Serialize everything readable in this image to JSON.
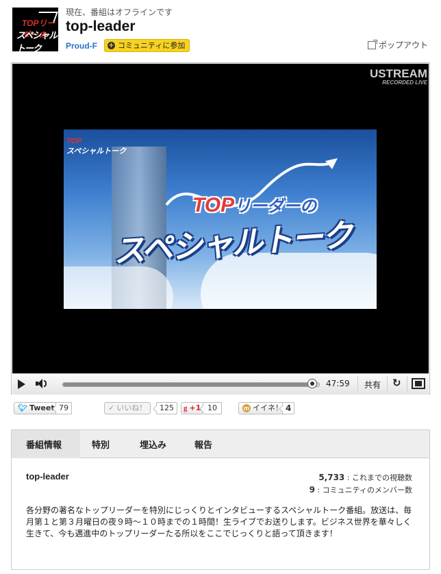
{
  "header": {
    "status": "現在、番組はオフラインです",
    "title": "top-leader",
    "channel": "Proud-F",
    "join_label": "コミュニティに参加",
    "popout_label": "ポップアウト",
    "logo_line1": "TOPリーダーの",
    "logo_line2": "スペシャルトーク"
  },
  "player": {
    "brand": "USTREAM",
    "badge": "RECORDED LIVE",
    "frame_small_1": "TOP",
    "frame_small_2": "スペシャルトーク",
    "frame_top": "TOP",
    "frame_top_suffix": "リーダーの",
    "frame_big": "スペシャルトーク",
    "time": "47:59",
    "share_label": "共有",
    "progress": 0.97
  },
  "social": {
    "tweet_label": "Tweet",
    "tweet_count": "79",
    "iine_label": "いいね！",
    "iine_count": "125",
    "gplus_label": "+1",
    "gplus_count": "10",
    "mixi_label": "イイネ！",
    "mixi_count": "4"
  },
  "tabs": [
    {
      "label": "番組情報",
      "active": true
    },
    {
      "label": "特別",
      "active": false
    },
    {
      "label": "埋込み",
      "active": false
    },
    {
      "label": "報告",
      "active": false
    }
  ],
  "info": {
    "name": "top-leader",
    "views_count": "5,733",
    "views_label": ": これまでの視聴数",
    "members_count": "9",
    "members_label": ": コミュニティのメンバー数",
    "description": "各分野の著名なトップリーダーを特別にじっくりとインタビューするスペシャルトーク番組。放送は、毎月第１と第３月曜日の夜９時〜１０時までの１時間！生ライブでお送りします。ビジネス世界を華々しく生きて、今も邁進中のトップリーダーたる所以をここでじっくりと語って頂きます！"
  },
  "colors": {
    "accent_link": "#2a73c9",
    "join_button": "#f7d21f",
    "twitter": "#2aa3ef"
  }
}
